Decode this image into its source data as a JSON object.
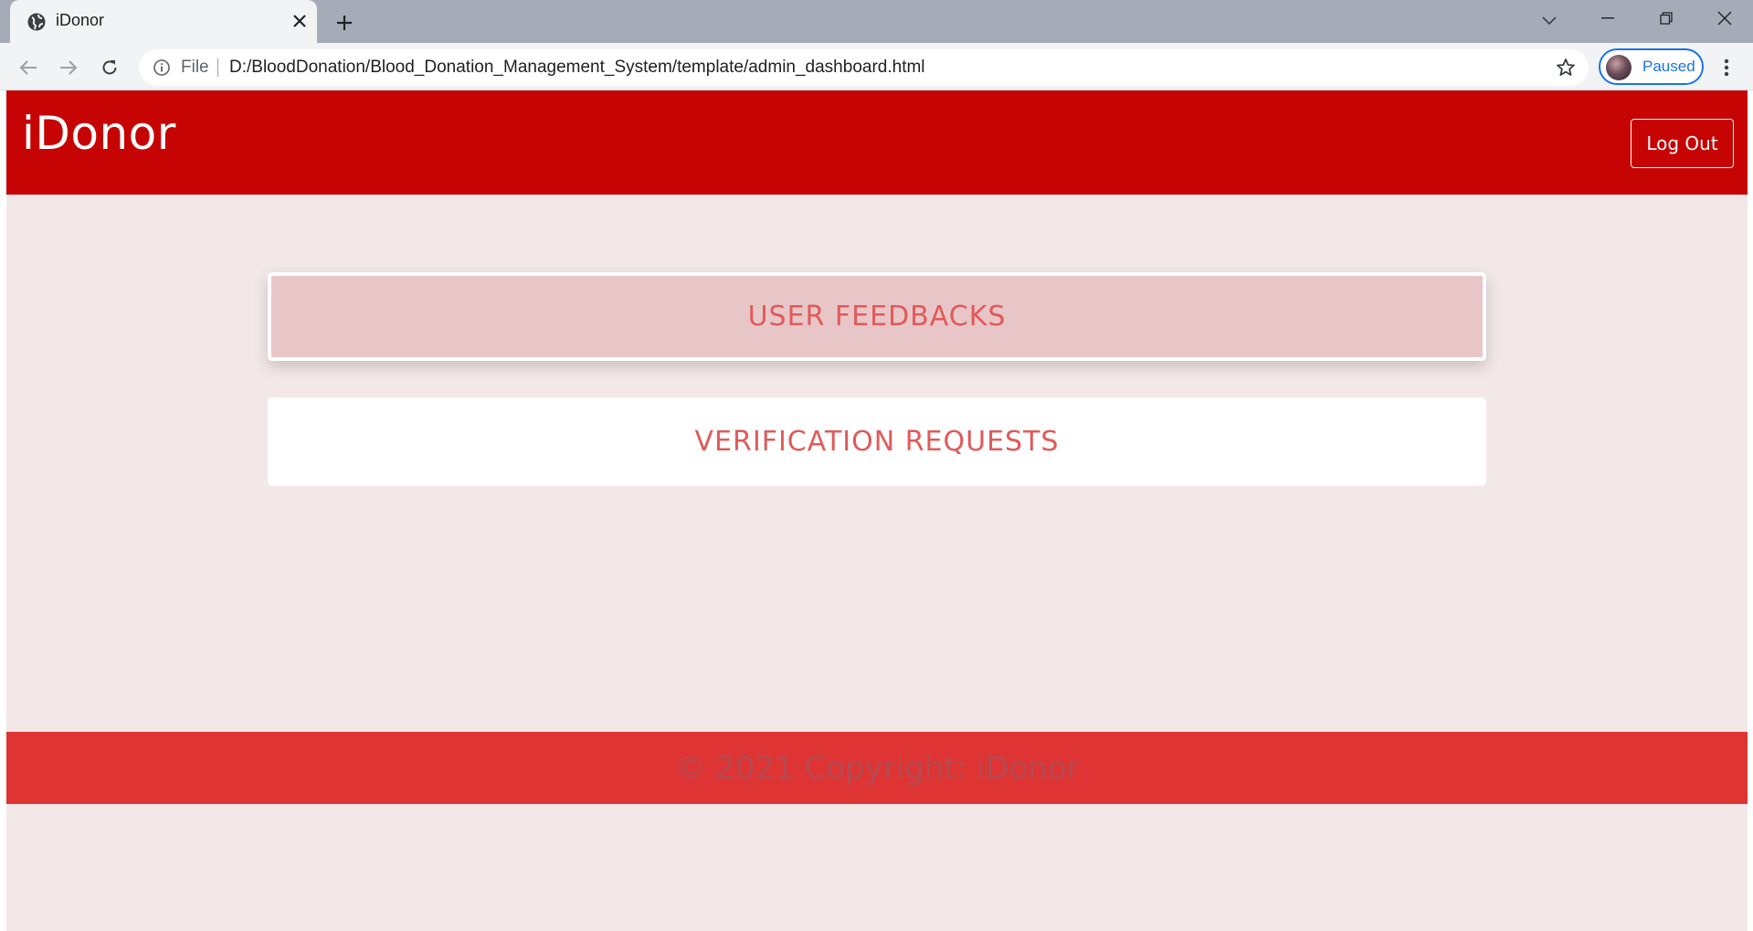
{
  "browser": {
    "tab": {
      "title": "iDonor"
    },
    "address": {
      "scheme_label": "File",
      "url": "D:/BloodDonation/Blood_Donation_Management_System/template/admin_dashboard.html"
    },
    "profile": {
      "label": "Paused"
    },
    "accent_color": "#1a73e8"
  },
  "header": {
    "brand": "iDonor",
    "logout_label": "Log Out",
    "background_color": "#c60404"
  },
  "main": {
    "cards": [
      {
        "label": "USER FEEDBACKS",
        "state": "hovered"
      },
      {
        "label": "VERIFICATION REQUESTS",
        "state": "normal"
      }
    ],
    "card_text_color": "#e05a5a"
  },
  "footer": {
    "text": "© 2021 Copyright: iDonor",
    "background_color": "#df3434"
  }
}
